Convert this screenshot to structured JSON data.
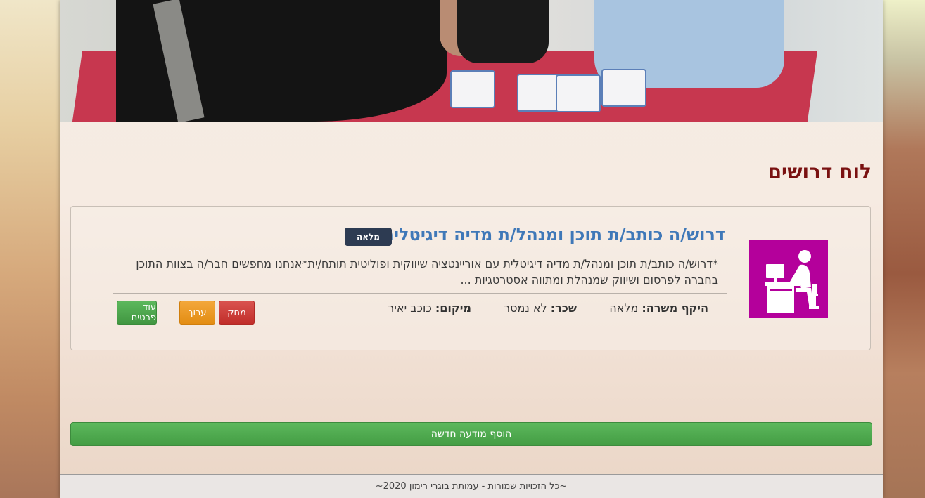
{
  "board": {
    "title": "לוח דרושים"
  },
  "job": {
    "title": "דרוש/ה כותב/ת תוכן ומנהל/ת מדיה דיגיטלית",
    "badge": "מלאה",
    "description": "*דרוש/ה כותב/ת תוכן ומנהל/ת מדיה דיגיטלית עם אוריינטציה שיווקית ופוליטית תותח/ית*אנחנו מחפשים חבר/ה בצוות התוכן בחברה לפרסום ושיווק שמנהלת ומתווה אסטרטגיות ...",
    "icon": "office-worker-icon",
    "icon_color": "#b4009b",
    "scope_label": "היקף משרה:",
    "scope_value": "מלאה",
    "salary_label": "שכר:",
    "salary_value": "לא נמסר",
    "location_label": "מיקום:",
    "location_value": "כוכב יאיר",
    "buttons": {
      "delete": "מחק",
      "edit": "ערוך",
      "more": "עוד פרטים"
    }
  },
  "add_button": "הוסף מודעה חדשה",
  "footer": "~כל הזכויות שמורות - עמותת בוגרי רימון 2020~",
  "colors": {
    "title": "#7a1111",
    "job_title": "#3f78b8",
    "badge": "#2d3b52",
    "green": "#5cb85c",
    "orange": "#f0a030",
    "red": "#d9534f"
  }
}
